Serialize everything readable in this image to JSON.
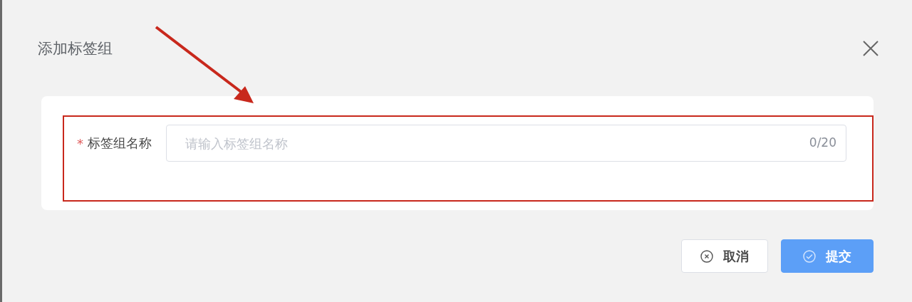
{
  "dialog": {
    "title": "添加标签组"
  },
  "form": {
    "fields": [
      {
        "required_mark": "*",
        "label": "标签组名称",
        "placeholder": "请输入标签组名称",
        "counter": "0/20"
      }
    ]
  },
  "buttons": [
    {
      "kind": "cancel",
      "label": "取消"
    },
    {
      "kind": "submit",
      "label": "提交"
    }
  ],
  "annotation": {
    "kind": "highlight"
  }
}
